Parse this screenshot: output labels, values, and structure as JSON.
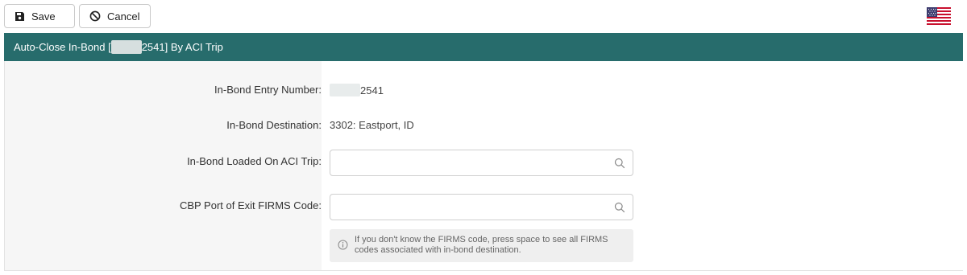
{
  "toolbar": {
    "save_label": "Save",
    "cancel_label": "Cancel"
  },
  "header": {
    "title_prefix": "Auto-Close In-Bond [",
    "title_suffix": "2541] By ACI Trip"
  },
  "form": {
    "entry_number": {
      "label": "In-Bond Entry Number:",
      "value_suffix": "2541"
    },
    "destination": {
      "label": "In-Bond Destination:",
      "value": "3302: Eastport, ID"
    },
    "aci_trip": {
      "label": "In-Bond Loaded On ACI Trip:",
      "value": ""
    },
    "firms_code": {
      "label": "CBP Port of Exit FIRMS Code:",
      "value": ""
    },
    "hint": "If you don't know the FIRMS code, press space to see all FIRMS codes associated with in-bond destination."
  },
  "colors": {
    "header_bg": "#276c6c"
  },
  "icons": {
    "save": "floppy-disk-icon",
    "cancel": "ban-icon",
    "search": "search-icon",
    "info": "info-icon",
    "flag": "us-flag-icon"
  }
}
